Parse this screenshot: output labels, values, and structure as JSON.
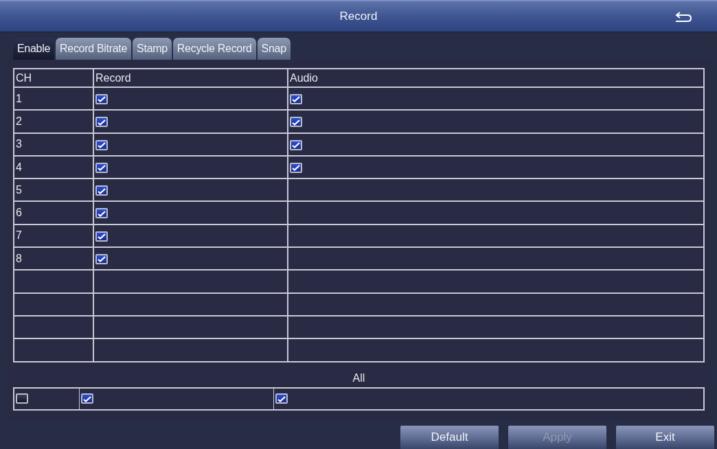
{
  "window": {
    "title": "Record"
  },
  "tabs": [
    {
      "label": "Enable",
      "selected": true
    },
    {
      "label": "Record Bitrate",
      "selected": false
    },
    {
      "label": "Stamp",
      "selected": false
    },
    {
      "label": "Recycle Record",
      "selected": false
    },
    {
      "label": "Snap",
      "selected": false
    }
  ],
  "table": {
    "columns": [
      "CH",
      "Record",
      "Audio"
    ],
    "rows": [
      {
        "ch": "1",
        "record_checked": true,
        "audio_checked": true
      },
      {
        "ch": "2",
        "record_checked": true,
        "audio_checked": true
      },
      {
        "ch": "3",
        "record_checked": true,
        "audio_checked": true
      },
      {
        "ch": "4",
        "record_checked": true,
        "audio_checked": true
      },
      {
        "ch": "5",
        "record_checked": true
      },
      {
        "ch": "6",
        "record_checked": true
      },
      {
        "ch": "7",
        "record_checked": true
      },
      {
        "ch": "8",
        "record_checked": true
      }
    ]
  },
  "all": {
    "label": "All",
    "ch_checked": false,
    "record_checked": true,
    "audio_checked": true
  },
  "buttons": [
    {
      "label": "Default",
      "disabled": false
    },
    {
      "label": "Apply",
      "disabled": true
    },
    {
      "label": "Exit",
      "disabled": false
    }
  ]
}
